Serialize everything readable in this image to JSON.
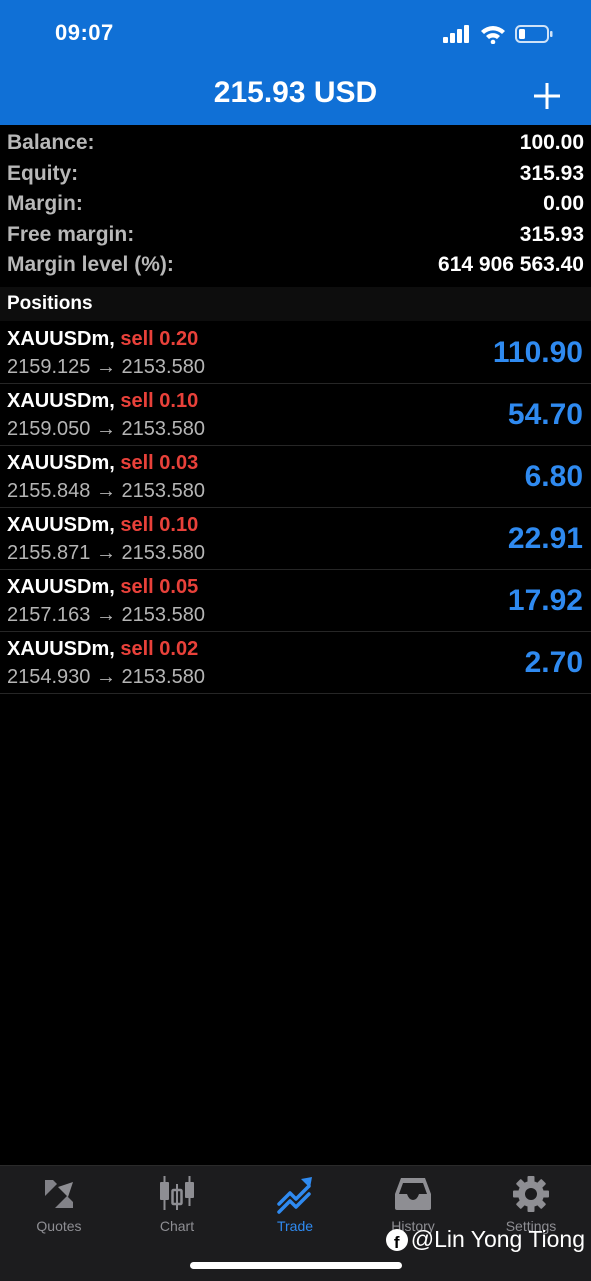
{
  "status_bar": {
    "time": "09:07",
    "icons": [
      "signal-icon",
      "wifi-icon",
      "battery-icon"
    ]
  },
  "header": {
    "title": "215.93 USD",
    "add_icon": "plus-icon"
  },
  "account": {
    "rows": [
      {
        "label": "Balance:",
        "value": "100.00"
      },
      {
        "label": "Equity:",
        "value": "315.93"
      },
      {
        "label": "Margin:",
        "value": "0.00"
      },
      {
        "label": "Free margin:",
        "value": "315.93"
      },
      {
        "label": "Margin level (%):",
        "value": "614 906 563.40"
      }
    ]
  },
  "positions": {
    "title": "Positions",
    "items": [
      {
        "symbol": "XAUUSDm,",
        "side": "sell 0.20",
        "prices": "2159.125 → 2153.580",
        "profit": "110.90"
      },
      {
        "symbol": "XAUUSDm,",
        "side": "sell 0.10",
        "prices": "2159.050 → 2153.580",
        "profit": "54.70"
      },
      {
        "symbol": "XAUUSDm,",
        "side": "sell 0.03",
        "prices": "2155.848 → 2153.580",
        "profit": "6.80"
      },
      {
        "symbol": "XAUUSDm,",
        "side": "sell 0.10",
        "prices": "2155.871 → 2153.580",
        "profit": "22.91"
      },
      {
        "symbol": "XAUUSDm,",
        "side": "sell 0.05",
        "prices": "2157.163 → 2153.580",
        "profit": "17.92"
      },
      {
        "symbol": "XAUUSDm,",
        "side": "sell 0.02",
        "prices": "2154.930 → 2153.580",
        "profit": "2.70"
      }
    ]
  },
  "tabbar": {
    "tabs": [
      {
        "label": "Quotes",
        "icon": "quotes-arrows-icon",
        "active": false
      },
      {
        "label": "Chart",
        "icon": "candlestick-chart-icon",
        "active": false
      },
      {
        "label": "Trade",
        "icon": "trade-trend-icon",
        "active": true
      },
      {
        "label": "History",
        "icon": "history-inbox-icon",
        "active": false
      },
      {
        "label": "Settings",
        "icon": "gear-icon",
        "active": false
      }
    ]
  },
  "watermark": {
    "text": "@Lin Yong Tiong",
    "icon": "facebook-icon"
  },
  "colors": {
    "header": "#1070d6",
    "sell": "#e8413a",
    "profit": "#2f8af0",
    "background": "#000000",
    "tabbar": "#1c1c1e"
  }
}
